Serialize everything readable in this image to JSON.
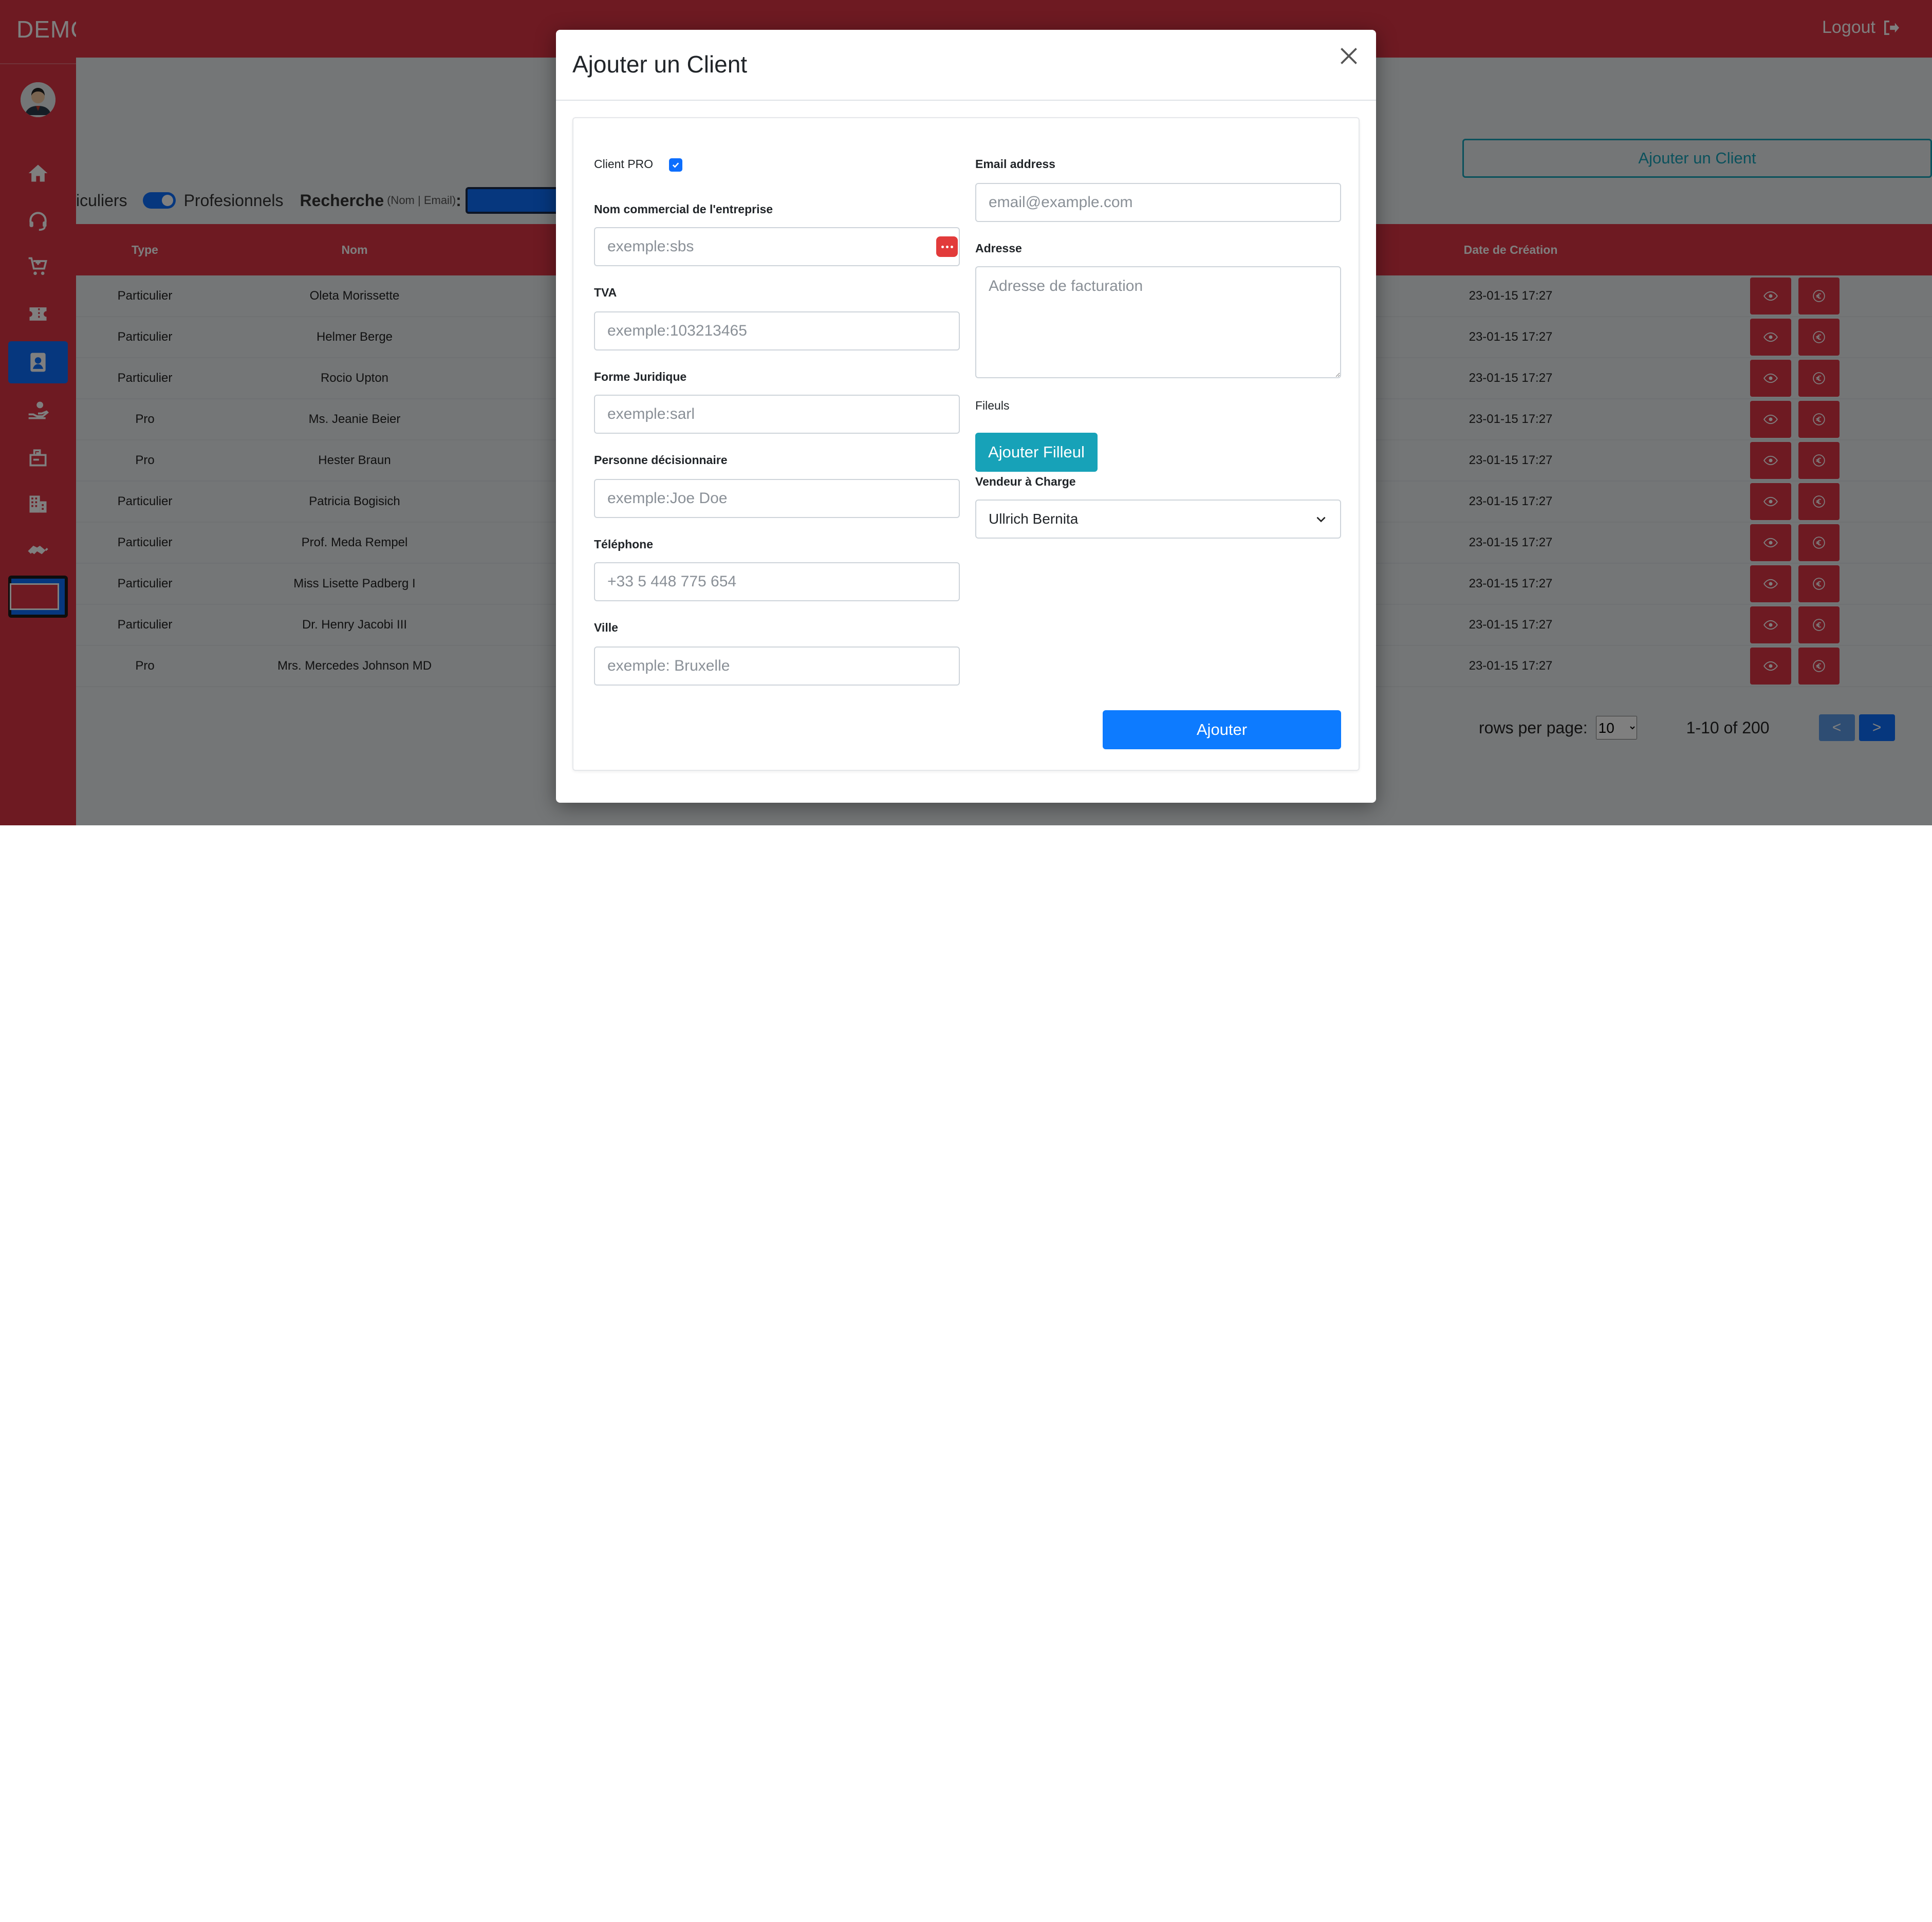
{
  "app": {
    "brand": "DEMC",
    "logout_label": "Logout"
  },
  "filters": {
    "particuliers_label": "iculiers",
    "professionnels_label": "Profesionnels",
    "search_label": "Recherche",
    "search_hint": "(Nom | Email)",
    "search_colon": ":"
  },
  "add_client_button": "Ajouter un Client",
  "table": {
    "headers": {
      "type": "Type",
      "nom": "Nom",
      "date": "Date de Création"
    },
    "rows": [
      {
        "type": "Particulier",
        "nom": "Oleta Morissette",
        "date": "23-01-15 17:27"
      },
      {
        "type": "Particulier",
        "nom": "Helmer Berge",
        "date": "23-01-15 17:27"
      },
      {
        "type": "Particulier",
        "nom": "Rocio Upton",
        "date": "23-01-15 17:27"
      },
      {
        "type": "Pro",
        "nom": "Ms. Jeanie Beier",
        "date": "23-01-15 17:27"
      },
      {
        "type": "Pro",
        "nom": "Hester Braun",
        "date": "23-01-15 17:27"
      },
      {
        "type": "Particulier",
        "nom": "Patricia Bogisich",
        "date": "23-01-15 17:27"
      },
      {
        "type": "Particulier",
        "nom": "Prof. Meda Rempel",
        "date": "23-01-15 17:27"
      },
      {
        "type": "Particulier",
        "nom": "Miss Lisette Padberg I",
        "date": "23-01-15 17:27"
      },
      {
        "type": "Particulier",
        "nom": "Dr. Henry Jacobi III",
        "date": "23-01-15 17:27"
      },
      {
        "type": "Pro",
        "nom": "Mrs. Mercedes Johnson MD",
        "date": "23-01-15 17:27"
      }
    ]
  },
  "pagination": {
    "rows_per_page_label": "rows per page:",
    "rows_per_page_value": "10",
    "range": "1-10 of 200",
    "prev_label": "<",
    "next_label": ">"
  },
  "modal": {
    "title": "Ajouter un Client",
    "client_pro_label": "Client PRO",
    "client_pro_checked": true,
    "nom_commercial": {
      "label": "Nom commercial de l'entreprise",
      "placeholder": "exemple:sbs",
      "value": ""
    },
    "tva": {
      "label": "TVA",
      "placeholder": "exemple:103213465",
      "value": ""
    },
    "forme_juridique": {
      "label": "Forme Juridique",
      "placeholder": "exemple:sarl",
      "value": ""
    },
    "personne": {
      "label": "Personne décisionnaire",
      "placeholder": "exemple:Joe Doe",
      "value": ""
    },
    "telephone": {
      "label": "Téléphone",
      "placeholder": "+33 5 448 775 654",
      "value": ""
    },
    "ville": {
      "label": "Ville",
      "placeholder": "exemple: Bruxelle",
      "value": ""
    },
    "email": {
      "label": "Email address",
      "placeholder": "email@example.com",
      "value": ""
    },
    "adresse": {
      "label": "Adresse",
      "placeholder": "Adresse de facturation",
      "value": ""
    },
    "fileuls_label": "Fileuls",
    "ajouter_filleul_button": "Ajouter Filleul",
    "vendeur": {
      "label": "Vendeur à Charge",
      "selected": "Ullrich Bernita"
    },
    "submit_button": "Ajouter"
  },
  "colors": {
    "primary_red": "#dc3545",
    "primary_blue": "#0d6efd",
    "info_teal": "#17a2b8",
    "submit_blue": "#0d7bff"
  },
  "icons": {
    "sidebar": [
      "home-icon",
      "headset-icon",
      "cart-icon",
      "ticket-icon",
      "contact-card-icon",
      "hand-coin-icon",
      "mailbox-icon",
      "building-icon",
      "handshake-icon"
    ],
    "row_actions": [
      "eye-icon",
      "euro-icon"
    ]
  }
}
